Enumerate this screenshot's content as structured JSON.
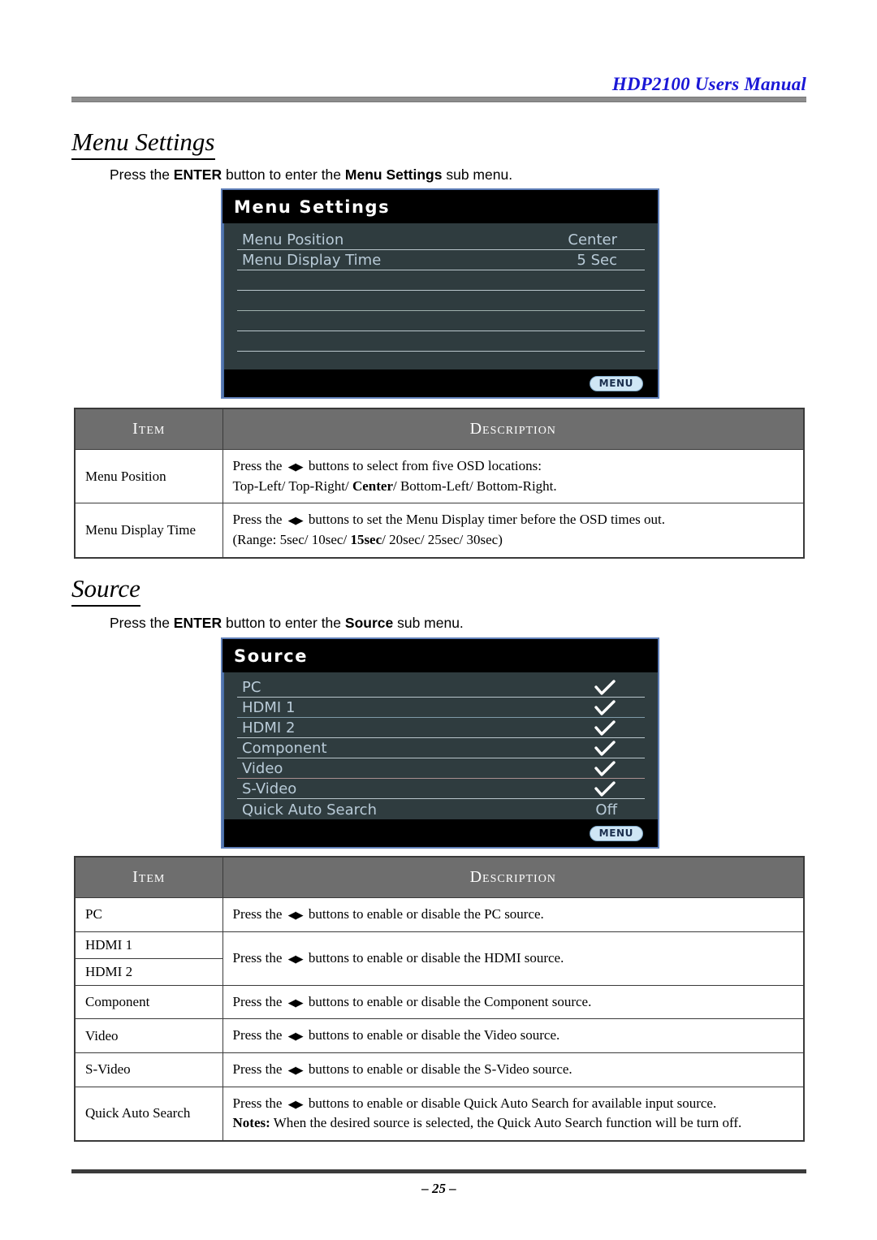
{
  "header": {
    "title": "HDP2100 Users Manual"
  },
  "footer": {
    "page_number": "– 25 –"
  },
  "sections": [
    {
      "heading": "Menu Settings",
      "intro_pre": "Press the ",
      "intro_b1": "ENTER",
      "intro_mid": " button to enter the ",
      "intro_b2": "Menu Settings",
      "intro_post": " sub menu."
    },
    {
      "heading": "Source",
      "intro_pre": "Press the ",
      "intro_b1": "ENTER",
      "intro_mid": " button to enter the ",
      "intro_b2": "Source",
      "intro_post": " sub menu."
    }
  ],
  "osd_menu_settings": {
    "title": "Menu Settings",
    "rows": [
      {
        "label": "Menu Position",
        "value": "Center"
      },
      {
        "label": "Menu Display Time",
        "value": "5 Sec"
      },
      {
        "label": "",
        "value": ""
      },
      {
        "label": "",
        "value": ""
      },
      {
        "label": "",
        "value": ""
      },
      {
        "label": "",
        "value": ""
      }
    ],
    "footer_button": "MENU"
  },
  "osd_source": {
    "title": "Source",
    "rows": [
      {
        "label": "PC",
        "value": "check"
      },
      {
        "label": "HDMI 1",
        "value": "check"
      },
      {
        "label": "HDMI 2",
        "value": "check"
      },
      {
        "label": "Component",
        "value": "check"
      },
      {
        "label": "Video",
        "value": "check"
      },
      {
        "label": "S-Video",
        "value": "check"
      },
      {
        "label": "Quick Auto Search",
        "value": "Off"
      }
    ],
    "footer_button": "MENU"
  },
  "table_menu_settings": {
    "headers": {
      "item": "Item",
      "description": "Description"
    },
    "rows": [
      {
        "item": "Menu Position",
        "line1_pre": "Press the ",
        "line1_arrows": "◀▶",
        "line1_post": " buttons to select from five OSD locations:",
        "line2_pre": "Top-Left/ Top-Right/ ",
        "line2_bold": "Center",
        "line2_post": "/ Bottom-Left/ Bottom-Right."
      },
      {
        "item": "Menu Display Time",
        "line1_pre": "Press the ",
        "line1_arrows": "◀▶",
        "line1_post": " buttons to set the Menu Display timer before the OSD times out.",
        "line2_pre": "(Range: 5sec/ 10sec/ ",
        "line2_bold": "15sec",
        "line2_post": "/ 20sec/ 25sec/ 30sec)"
      }
    ]
  },
  "table_source": {
    "headers": {
      "item": "Item",
      "description": "Description"
    },
    "rows": [
      {
        "item": "PC",
        "desc_pre": "Press the ",
        "desc_arrows": "◀▶",
        "desc_post": " buttons to enable or disable the PC source."
      },
      {
        "item": "HDMI 1",
        "item2": "HDMI 2",
        "desc_pre": "Press the ",
        "desc_arrows": "◀▶",
        "desc_post": " buttons to enable or disable the HDMI source."
      },
      {
        "item": "Component",
        "desc_pre": "Press the ",
        "desc_arrows": "◀▶",
        "desc_post": " buttons to enable or disable the Component source."
      },
      {
        "item": "Video",
        "desc_pre": "Press the ",
        "desc_arrows": "◀▶",
        "desc_post": " buttons to enable or disable the Video source."
      },
      {
        "item": "S-Video",
        "desc_pre": "Press the ",
        "desc_arrows": "◀▶",
        "desc_post": " buttons to enable or disable the S-Video source."
      },
      {
        "item": "Quick Auto Search",
        "desc_pre": "Press the ",
        "desc_arrows": "◀▶",
        "desc_post": " buttons to enable or disable Quick Auto Search for available input source.",
        "notes_label": "Notes:",
        "notes_text": " When the desired source is selected, the Quick Auto Search function will be turn off."
      }
    ]
  }
}
